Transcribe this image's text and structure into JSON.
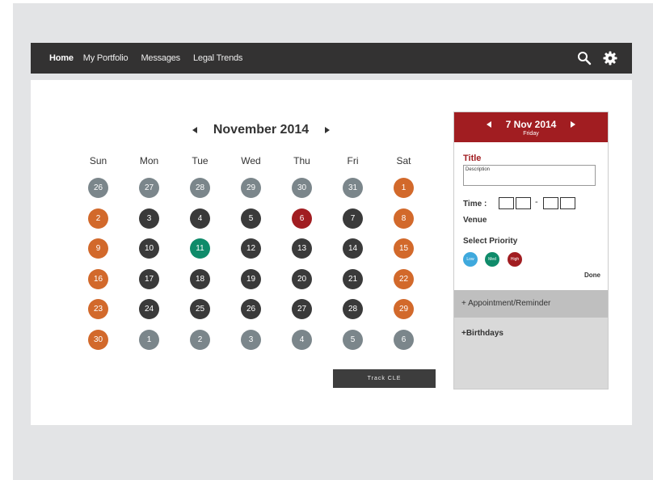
{
  "nav": {
    "links": [
      "Home",
      "My Portfolio",
      "Messages",
      "Legal Trends"
    ],
    "active": "Home",
    "icons": [
      "search-icon",
      "gear-icon"
    ]
  },
  "calendar": {
    "month_label": "November 2014",
    "weekdays": [
      "Sun",
      "Mon",
      "Tue",
      "Wed",
      "Thu",
      "Fri",
      "Sat"
    ],
    "colors": {
      "outside": "#7b868b",
      "weekday": "#3a3a3a",
      "weekend": "#d2692b",
      "selected": "#0f8b6a",
      "today": "#a11d21"
    },
    "weeks": [
      [
        {
          "d": "26",
          "t": "outside"
        },
        {
          "d": "27",
          "t": "outside"
        },
        {
          "d": "28",
          "t": "outside"
        },
        {
          "d": "29",
          "t": "outside"
        },
        {
          "d": "30",
          "t": "outside"
        },
        {
          "d": "31",
          "t": "outside"
        },
        {
          "d": "1",
          "t": "weekend"
        }
      ],
      [
        {
          "d": "2",
          "t": "weekend"
        },
        {
          "d": "3",
          "t": "weekday"
        },
        {
          "d": "4",
          "t": "weekday"
        },
        {
          "d": "5",
          "t": "weekday"
        },
        {
          "d": "6",
          "t": "today"
        },
        {
          "d": "7",
          "t": "weekday"
        },
        {
          "d": "8",
          "t": "weekend"
        }
      ],
      [
        {
          "d": "9",
          "t": "weekend"
        },
        {
          "d": "10",
          "t": "weekday"
        },
        {
          "d": "11",
          "t": "selected"
        },
        {
          "d": "12",
          "t": "weekday"
        },
        {
          "d": "13",
          "t": "weekday"
        },
        {
          "d": "14",
          "t": "weekday"
        },
        {
          "d": "15",
          "t": "weekend"
        }
      ],
      [
        {
          "d": "16",
          "t": "weekend"
        },
        {
          "d": "17",
          "t": "weekday"
        },
        {
          "d": "18",
          "t": "weekday"
        },
        {
          "d": "19",
          "t": "weekday"
        },
        {
          "d": "20",
          "t": "weekday"
        },
        {
          "d": "21",
          "t": "weekday"
        },
        {
          "d": "22",
          "t": "weekend"
        }
      ],
      [
        {
          "d": "23",
          "t": "weekend"
        },
        {
          "d": "24",
          "t": "weekday"
        },
        {
          "d": "25",
          "t": "weekday"
        },
        {
          "d": "26",
          "t": "weekday"
        },
        {
          "d": "27",
          "t": "weekday"
        },
        {
          "d": "28",
          "t": "weekday"
        },
        {
          "d": "29",
          "t": "weekend"
        }
      ],
      [
        {
          "d": "30",
          "t": "weekend"
        },
        {
          "d": "1",
          "t": "outside"
        },
        {
          "d": "2",
          "t": "outside"
        },
        {
          "d": "3",
          "t": "outside"
        },
        {
          "d": "4",
          "t": "outside"
        },
        {
          "d": "5",
          "t": "outside"
        },
        {
          "d": "6",
          "t": "outside"
        }
      ]
    ],
    "track_button": "Track CLE"
  },
  "panel": {
    "date": "7 Nov 2014",
    "weekday": "Friday",
    "title_label": "Title",
    "description_placeholder": "Description",
    "time_label": "Time :",
    "time_separator": "-",
    "venue_label": "Venue",
    "priority_label": "Select Priority",
    "priorities": [
      {
        "label": "Low",
        "color": "#3fa9dd"
      },
      {
        "label": "Med",
        "color": "#0f8b6a"
      },
      {
        "label": "High",
        "color": "#a11d21"
      }
    ],
    "done_label": "Done",
    "appointment_label": "+ Appointment/Reminder",
    "birthdays_label": "+Birthdays",
    "header_color": "#a11d21"
  }
}
